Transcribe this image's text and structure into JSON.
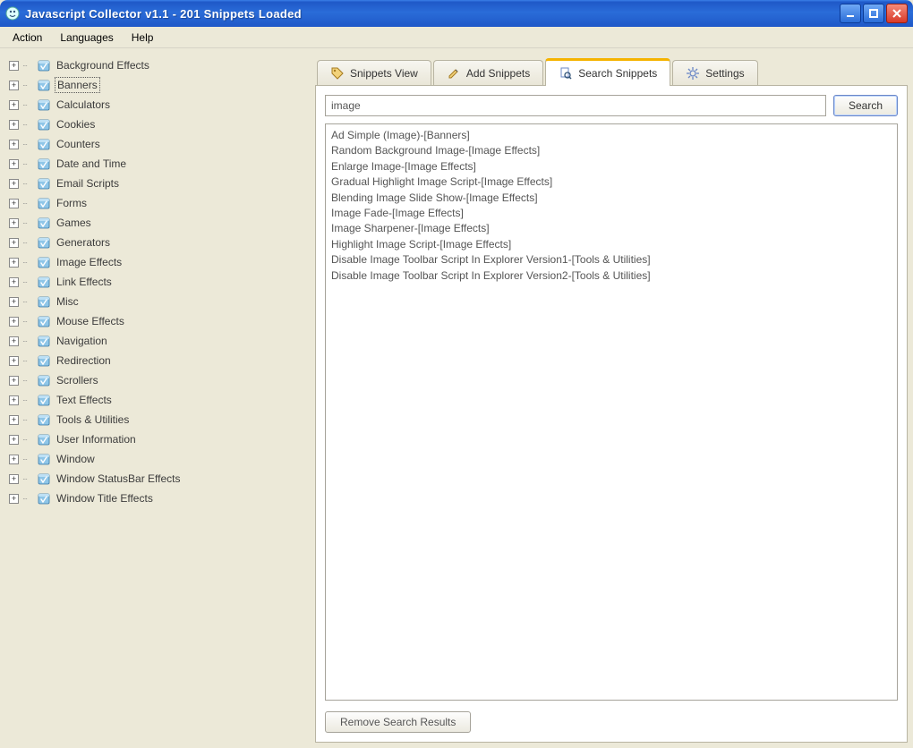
{
  "window": {
    "title": "Javascript Collector v1.1  -  201 Snippets Loaded"
  },
  "menu": {
    "items": [
      "Action",
      "Languages",
      "Help"
    ]
  },
  "sidebar": {
    "selected_index": 1,
    "categories": [
      "Background Effects",
      "Banners",
      "Calculators",
      "Cookies",
      "Counters",
      "Date and Time",
      "Email Scripts",
      "Forms",
      "Games",
      "Generators",
      "Image Effects",
      "Link Effects",
      "Misc",
      "Mouse Effects",
      "Navigation",
      "Redirection",
      "Scrollers",
      "Text Effects",
      "Tools & Utilities",
      "User Information",
      "Window",
      "Window StatusBar Effects",
      "Window Title Effects"
    ]
  },
  "tabs": {
    "items": [
      {
        "label": "Snippets View",
        "icon": "tag-icon"
      },
      {
        "label": "Add Snippets",
        "icon": "edit-icon"
      },
      {
        "label": "Search Snippets",
        "icon": "search-doc-icon"
      },
      {
        "label": "Settings",
        "icon": "gear-icon"
      }
    ],
    "active_index": 2
  },
  "search": {
    "query": "image",
    "search_button": "Search",
    "remove_button": "Remove Search Results",
    "results": [
      "Ad Simple (Image)-[Banners]",
      "Random Background Image-[Image Effects]",
      "Enlarge Image-[Image Effects]",
      "Gradual Highlight Image Script-[Image Effects]",
      "Blending Image Slide Show-[Image Effects]",
      "Image Fade-[Image Effects]",
      "Image Sharpener-[Image Effects]",
      "Highlight Image Script-[Image Effects]",
      "Disable Image Toolbar Script In Explorer Version1-[Tools & Utilities]",
      "Disable Image Toolbar Script In Explorer Version2-[Tools & Utilities]"
    ]
  }
}
